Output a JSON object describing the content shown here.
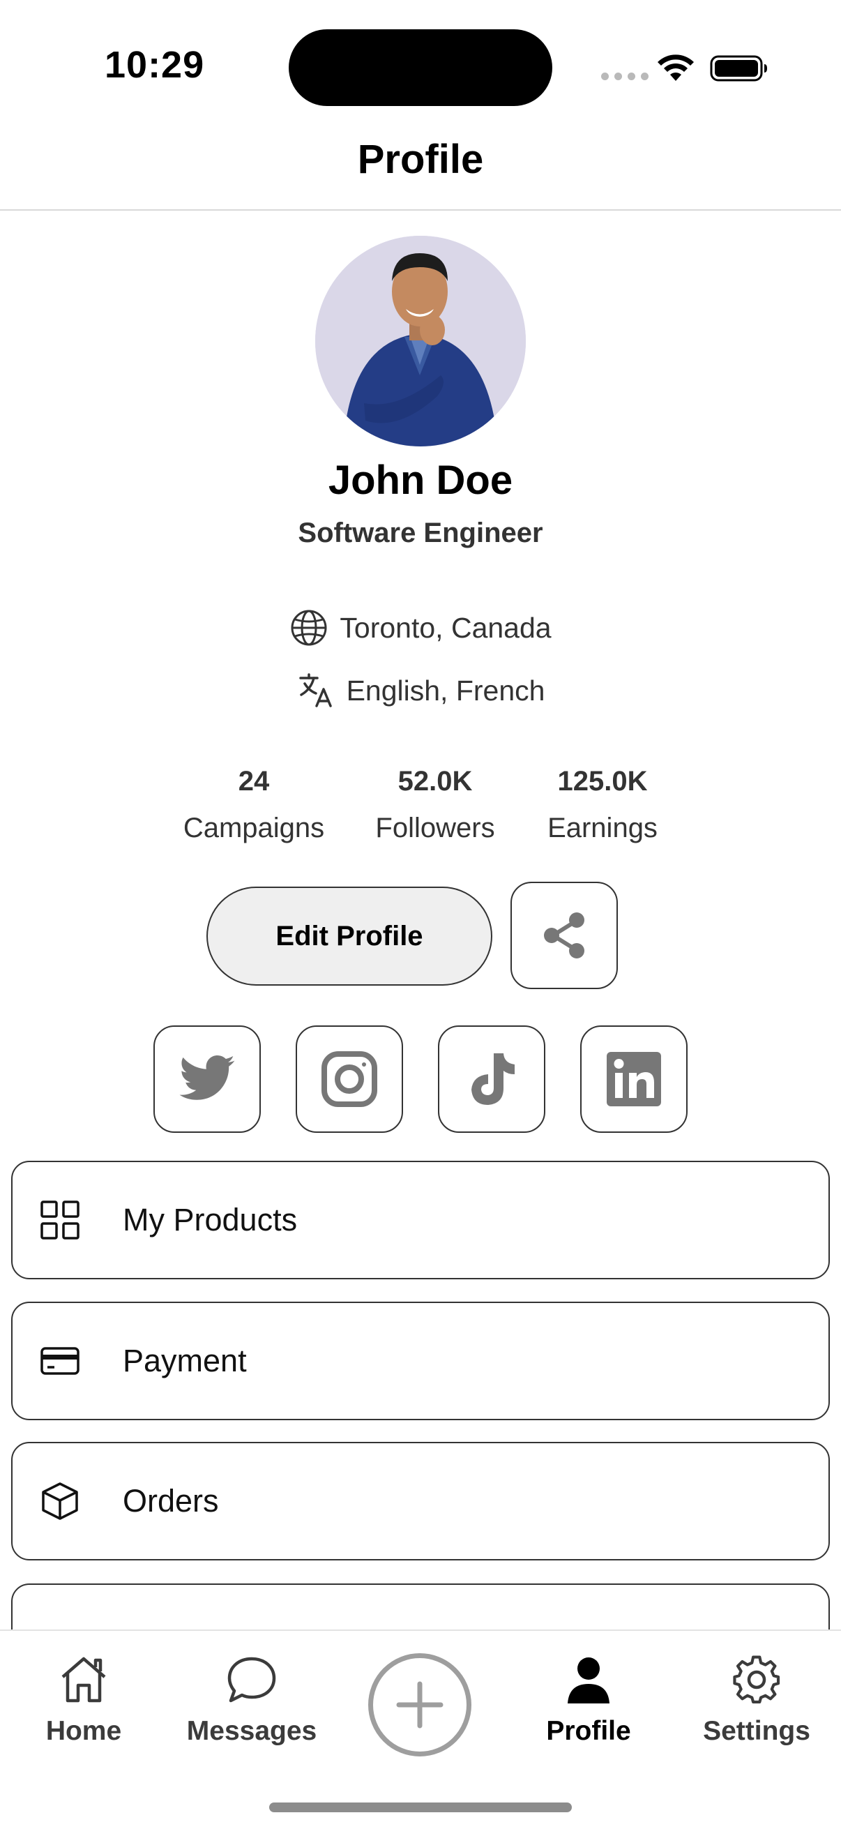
{
  "status_bar": {
    "time": "10:29"
  },
  "header": {
    "title": "Profile"
  },
  "profile": {
    "name": "John Doe",
    "role": "Software Engineer",
    "location": "Toronto, Canada",
    "languages": "English, French"
  },
  "stats": [
    {
      "value": "24",
      "label": "Campaigns"
    },
    {
      "value": "52.0K",
      "label": "Followers"
    },
    {
      "value": "125.0K",
      "label": "Earnings"
    }
  ],
  "actions": {
    "edit_label": "Edit Profile"
  },
  "menu": [
    {
      "label": "My Products",
      "icon": "grid-icon"
    },
    {
      "label": "Payment",
      "icon": "credit-card-icon"
    },
    {
      "label": "Orders",
      "icon": "box-icon"
    }
  ],
  "tabs": {
    "home": "Home",
    "messages": "Messages",
    "profile": "Profile",
    "settings": "Settings",
    "active": "profile"
  },
  "colors": {
    "text": "#000000",
    "secondary_text": "#333333",
    "border": "#333333",
    "edit_button_bg": "#efefef",
    "social_icon": "#777777",
    "inactive_add": "#9e9e9e"
  }
}
